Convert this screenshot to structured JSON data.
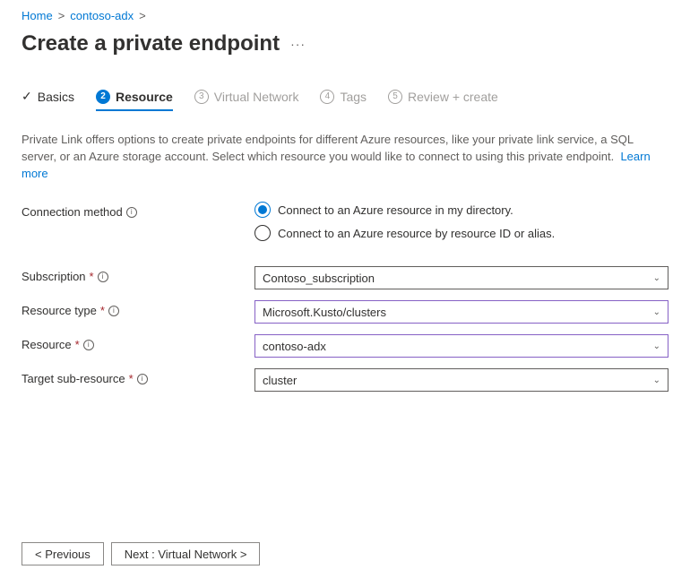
{
  "breadcrumb": {
    "home": "Home",
    "resource": "contoso-adx"
  },
  "page_title": "Create a private endpoint",
  "tabs": {
    "basics": "Basics",
    "resource": "Resource",
    "vnet": "Virtual Network",
    "tags": "Tags",
    "review": "Review + create",
    "num_vnet": "3",
    "num_tags": "4",
    "num_review": "5",
    "num_resource": "2"
  },
  "description": {
    "text": "Private Link offers options to create private endpoints for different Azure resources, like your private link service, a SQL server, or an Azure storage account. Select which resource you would like to connect to using this private endpoint.",
    "learn_more": "Learn more"
  },
  "form": {
    "connection_method_label": "Connection method",
    "radio_in_directory": "Connect to an Azure resource in my directory.",
    "radio_by_id": "Connect to an Azure resource by resource ID or alias.",
    "subscription_label": "Subscription",
    "subscription_value": "Contoso_subscription",
    "resource_type_label": "Resource type",
    "resource_type_value": "Microsoft.Kusto/clusters",
    "resource_label": "Resource",
    "resource_value": "contoso-adx",
    "target_sub_label": "Target sub-resource",
    "target_sub_value": "cluster"
  },
  "footer": {
    "previous": "<  Previous",
    "next": "Next : Virtual Network  >"
  }
}
